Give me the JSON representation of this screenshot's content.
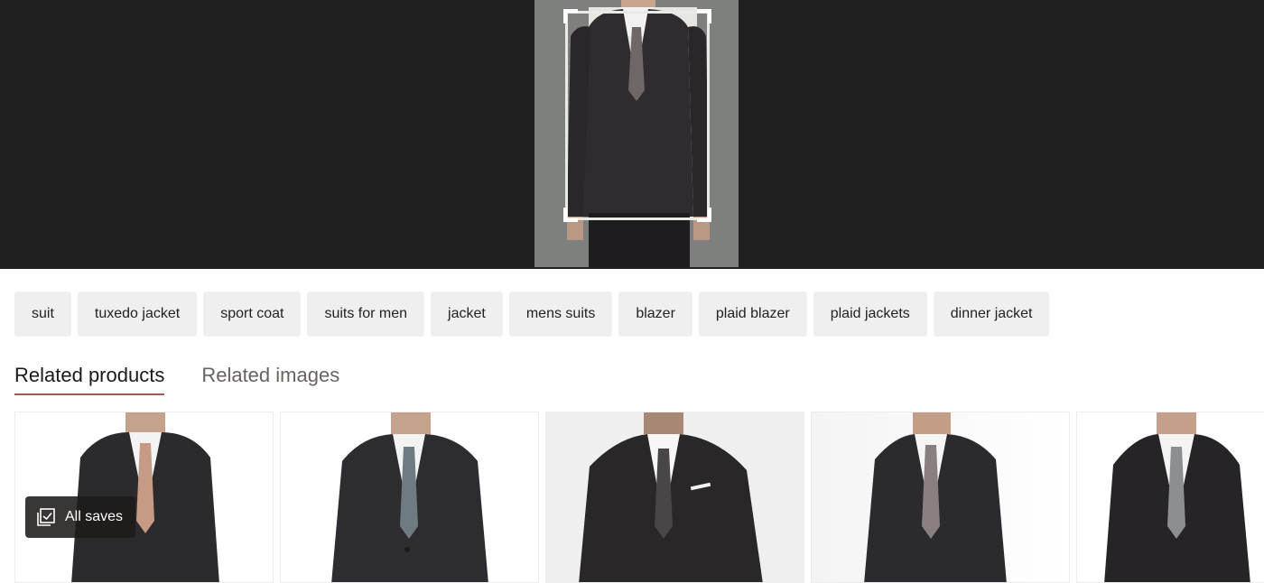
{
  "search_chips": [
    "suit",
    "tuxedo jacket",
    "sport coat",
    "suits for men",
    "jacket",
    "mens suits",
    "blazer",
    "plaid blazer",
    "plaid jackets",
    "dinner jacket"
  ],
  "tabs": [
    {
      "label": "Related products",
      "active": true
    },
    {
      "label": "Related images",
      "active": false
    }
  ],
  "saves": {
    "label": "All saves"
  },
  "colors": {
    "viewer_bg": "#202020",
    "chip_bg": "#efefef",
    "tab_underline": "#a05a4e"
  }
}
